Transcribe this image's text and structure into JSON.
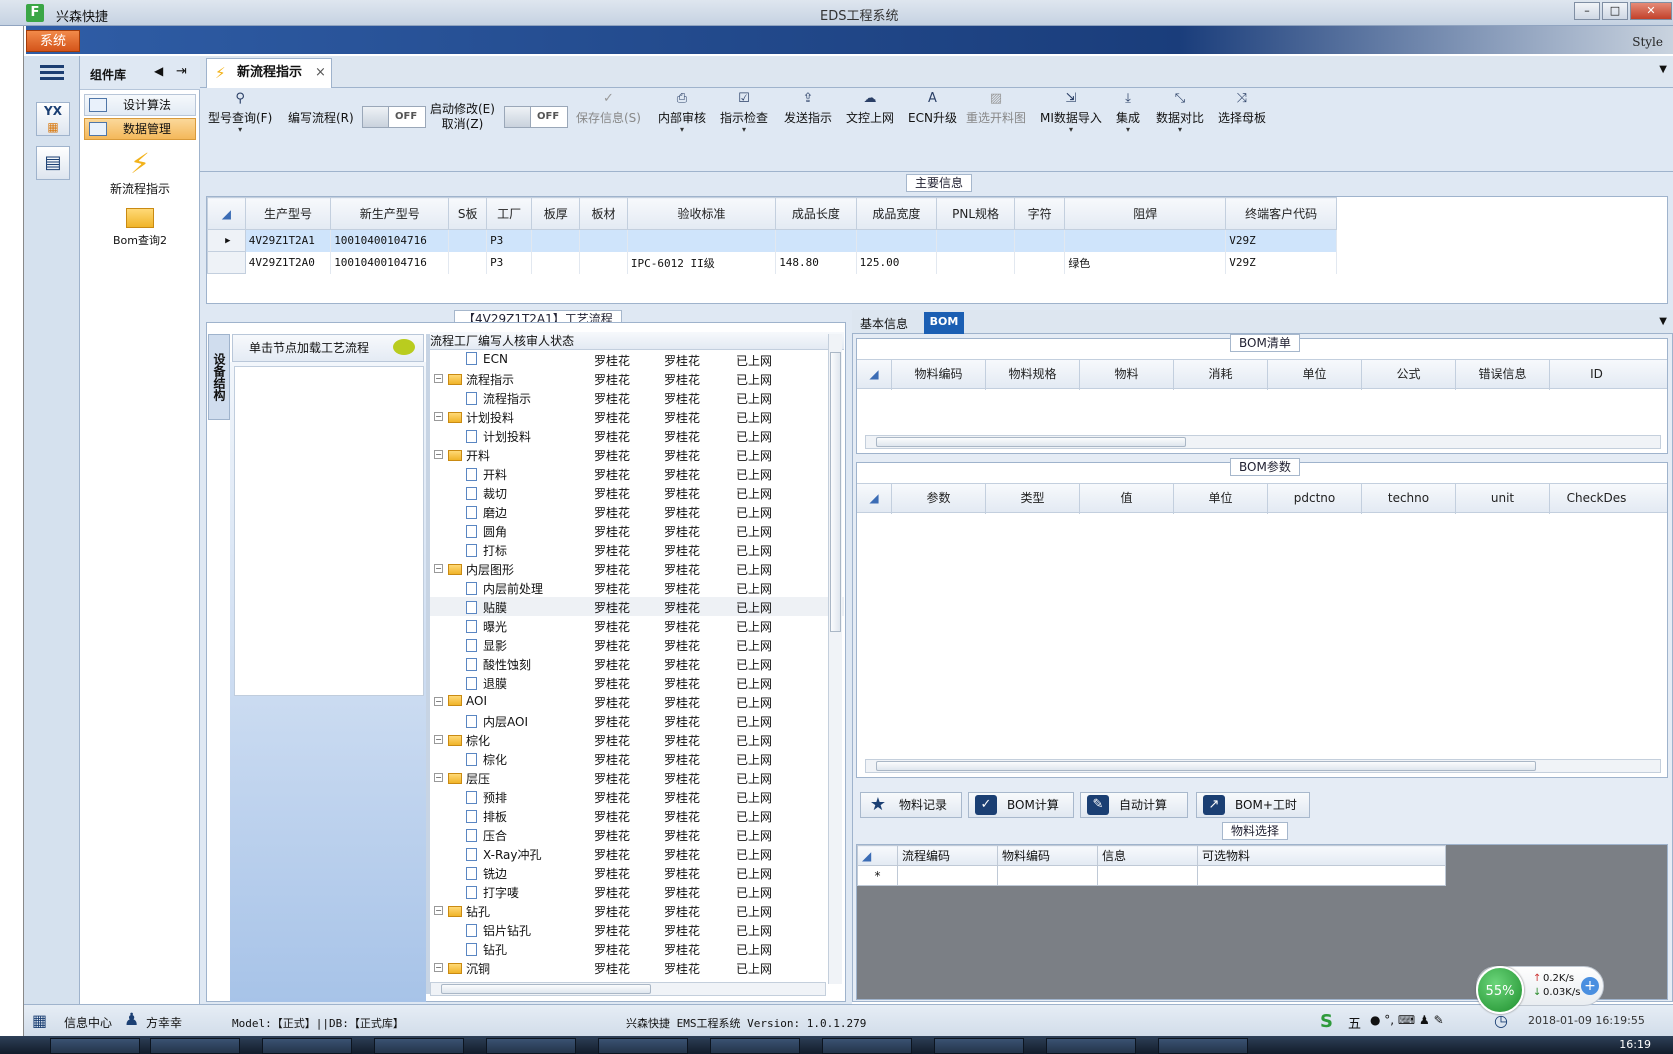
{
  "window": {
    "app_name": "兴森快捷",
    "title": "EDS工程系统",
    "style_label": "Style"
  },
  "ribbon": {
    "system_button": "系统"
  },
  "component_library": {
    "title": "组件库",
    "items": [
      {
        "label": "设计算法"
      },
      {
        "label": "数据管理"
      }
    ],
    "big_items": [
      {
        "label": "新流程指示"
      },
      {
        "label": "Bom查询2"
      }
    ]
  },
  "tabs": [
    {
      "label": "新流程指示",
      "close": "×"
    }
  ],
  "toolbar": {
    "model_query": "型号查询(F)",
    "write_flow": "编写流程(R)",
    "toggle1_state": "OFF",
    "start_modify": "启动修改(E)",
    "cancel": "取消(Z)",
    "toggle2_state": "OFF",
    "save_info": "保存信息(S)",
    "internal_review": "内部审核",
    "instruction_check": "指示检查",
    "send_instruction": "发送指示",
    "doc_upload": "文控上网",
    "ecn_upgrade": "ECN升级",
    "reselect_chart": "重选开料图",
    "mi_import": "MI数据导入",
    "integrate": "集成",
    "data_compare": "数据对比",
    "select_mother": "选择母板"
  },
  "main_info": {
    "label": "主要信息",
    "columns": [
      "生产型号",
      "新生产型号",
      "S板",
      "工厂",
      "板厚",
      "板材",
      "验收标准",
      "成品长度",
      "成品宽度",
      "PNL规格",
      "字符",
      "阻焊",
      "终端客户代码"
    ],
    "rows": [
      [
        "4V29Z1T2A1",
        "10010400104716",
        "",
        "P3",
        "",
        "",
        "",
        "",
        "",
        "",
        "",
        "",
        "V29Z"
      ],
      [
        "4V29Z1T2A0",
        "10010400104716",
        "",
        "P3",
        "",
        "",
        "IPC-6012 II级",
        "148.80",
        "125.00",
        "",
        "",
        "绿色",
        "V29Z"
      ]
    ]
  },
  "process": {
    "label": "【4V29Z1T2A1】工艺流程",
    "side_tab": "设备结构",
    "click_hint": "单击节点加载工艺流程",
    "columns": [
      "流程",
      "工厂",
      "编写人",
      "核审人",
      "状态"
    ],
    "rows": [
      {
        "name": "ECN",
        "level": 1,
        "type": "page",
        "writer": "罗桂花",
        "reviewer": "罗桂花",
        "status": "已上网"
      },
      {
        "name": "流程指示",
        "level": 0,
        "type": "folder",
        "writer": "罗桂花",
        "reviewer": "罗桂花",
        "status": "已上网"
      },
      {
        "name": "流程指示",
        "level": 1,
        "type": "page",
        "writer": "罗桂花",
        "reviewer": "罗桂花",
        "status": "已上网"
      },
      {
        "name": "计划投料",
        "level": 0,
        "type": "folder",
        "writer": "罗桂花",
        "reviewer": "罗桂花",
        "status": "已上网"
      },
      {
        "name": "计划投料",
        "level": 1,
        "type": "page",
        "writer": "罗桂花",
        "reviewer": "罗桂花",
        "status": "已上网"
      },
      {
        "name": "开料",
        "level": 0,
        "type": "folder",
        "writer": "罗桂花",
        "reviewer": "罗桂花",
        "status": "已上网"
      },
      {
        "name": "开料",
        "level": 1,
        "type": "page",
        "writer": "罗桂花",
        "reviewer": "罗桂花",
        "status": "已上网"
      },
      {
        "name": "裁切",
        "level": 1,
        "type": "page",
        "writer": "罗桂花",
        "reviewer": "罗桂花",
        "status": "已上网"
      },
      {
        "name": "磨边",
        "level": 1,
        "type": "page",
        "writer": "罗桂花",
        "reviewer": "罗桂花",
        "status": "已上网"
      },
      {
        "name": "圆角",
        "level": 1,
        "type": "page",
        "writer": "罗桂花",
        "reviewer": "罗桂花",
        "status": "已上网"
      },
      {
        "name": "打标",
        "level": 1,
        "type": "page",
        "writer": "罗桂花",
        "reviewer": "罗桂花",
        "status": "已上网"
      },
      {
        "name": "内层图形",
        "level": 0,
        "type": "folder",
        "writer": "罗桂花",
        "reviewer": "罗桂花",
        "status": "已上网"
      },
      {
        "name": "内层前处理",
        "level": 1,
        "type": "page",
        "writer": "罗桂花",
        "reviewer": "罗桂花",
        "status": "已上网"
      },
      {
        "name": "贴膜",
        "level": 1,
        "type": "page",
        "writer": "罗桂花",
        "reviewer": "罗桂花",
        "status": "已上网"
      },
      {
        "name": "曝光",
        "level": 1,
        "type": "page",
        "writer": "罗桂花",
        "reviewer": "罗桂花",
        "status": "已上网"
      },
      {
        "name": "显影",
        "level": 1,
        "type": "page",
        "writer": "罗桂花",
        "reviewer": "罗桂花",
        "status": "已上网"
      },
      {
        "name": "酸性蚀刻",
        "level": 1,
        "type": "page",
        "writer": "罗桂花",
        "reviewer": "罗桂花",
        "status": "已上网"
      },
      {
        "name": "退膜",
        "level": 1,
        "type": "page",
        "writer": "罗桂花",
        "reviewer": "罗桂花",
        "status": "已上网"
      },
      {
        "name": "AOI",
        "level": 0,
        "type": "folder",
        "writer": "罗桂花",
        "reviewer": "罗桂花",
        "status": "已上网"
      },
      {
        "name": "内层AOI",
        "level": 1,
        "type": "page",
        "writer": "罗桂花",
        "reviewer": "罗桂花",
        "status": "已上网"
      },
      {
        "name": "棕化",
        "level": 0,
        "type": "folder",
        "writer": "罗桂花",
        "reviewer": "罗桂花",
        "status": "已上网"
      },
      {
        "name": "棕化",
        "level": 1,
        "type": "page",
        "writer": "罗桂花",
        "reviewer": "罗桂花",
        "status": "已上网"
      },
      {
        "name": "层压",
        "level": 0,
        "type": "folder",
        "writer": "罗桂花",
        "reviewer": "罗桂花",
        "status": "已上网"
      },
      {
        "name": "预排",
        "level": 1,
        "type": "page",
        "writer": "罗桂花",
        "reviewer": "罗桂花",
        "status": "已上网"
      },
      {
        "name": "排板",
        "level": 1,
        "type": "page",
        "writer": "罗桂花",
        "reviewer": "罗桂花",
        "status": "已上网"
      },
      {
        "name": "压合",
        "level": 1,
        "type": "page",
        "writer": "罗桂花",
        "reviewer": "罗桂花",
        "status": "已上网"
      },
      {
        "name": "X-Ray冲孔",
        "level": 1,
        "type": "page",
        "writer": "罗桂花",
        "reviewer": "罗桂花",
        "status": "已上网"
      },
      {
        "name": "铣边",
        "level": 1,
        "type": "page",
        "writer": "罗桂花",
        "reviewer": "罗桂花",
        "status": "已上网"
      },
      {
        "name": "打字唛",
        "level": 1,
        "type": "page",
        "writer": "罗桂花",
        "reviewer": "罗桂花",
        "status": "已上网"
      },
      {
        "name": "钻孔",
        "level": 0,
        "type": "folder",
        "writer": "罗桂花",
        "reviewer": "罗桂花",
        "status": "已上网"
      },
      {
        "name": "铝片钻孔",
        "level": 1,
        "type": "page",
        "writer": "罗桂花",
        "reviewer": "罗桂花",
        "status": "已上网"
      },
      {
        "name": "钻孔",
        "level": 1,
        "type": "page",
        "writer": "罗桂花",
        "reviewer": "罗桂花",
        "status": "已上网"
      },
      {
        "name": "沉铜",
        "level": 0,
        "type": "folder",
        "writer": "罗桂花",
        "reviewer": "罗桂花",
        "status": "已上网"
      }
    ]
  },
  "right_tabs": [
    {
      "label": "基本信息"
    },
    {
      "label": "BOM"
    }
  ],
  "bom_list": {
    "label": "BOM清单",
    "columns": [
      "物料编码",
      "物料规格",
      "物料",
      "消耗",
      "单位",
      "公式",
      "错误信息",
      "ID"
    ]
  },
  "bom_params": {
    "label": "BOM参数",
    "columns": [
      "参数",
      "类型",
      "值",
      "单位",
      "pdctno",
      "techno",
      "unit",
      "CheckDes"
    ]
  },
  "actions": [
    {
      "label": "物料记录",
      "icon": "star-icon"
    },
    {
      "label": "BOM计算",
      "icon": "check-icon"
    },
    {
      "label": "自动计算",
      "icon": "pencil-icon"
    },
    {
      "label": "BOM+工时",
      "icon": "arrow-icon"
    }
  ],
  "material_select": {
    "label": "物料选择",
    "columns": [
      "流程编码",
      "物料编码",
      "信息",
      "可选物料"
    ],
    "new_row_marker": "*"
  },
  "statusbar": {
    "info_center": "信息中心",
    "user": "方幸幸",
    "model": "Model:【正式】||DB:【正式库】",
    "version": "兴森快捷 EMS工程系统 Version: 1.0.1.279",
    "datetime": "2018-01-09 16:19:55"
  },
  "net_widget": {
    "percent": "55%",
    "up": "0.2K/s",
    "down": "0.03K/s"
  },
  "tray": {
    "ime": "五",
    "time": "16:19"
  },
  "colors": {
    "accent": "#1b3f73",
    "selected_row": "#cfe4fb",
    "system_button": "#e06a2a"
  }
}
